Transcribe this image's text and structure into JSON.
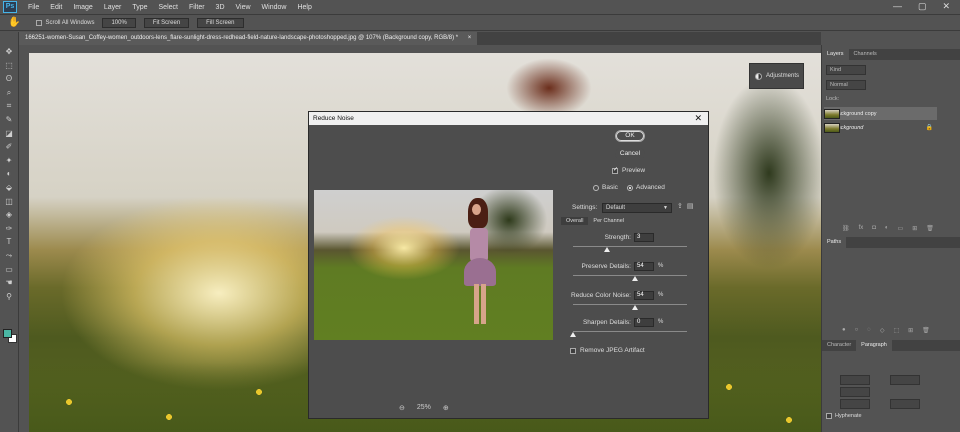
{
  "menubar": {
    "logo": "Ps",
    "items": [
      "File",
      "Edit",
      "Image",
      "Layer",
      "Type",
      "Select",
      "Filter",
      "3D",
      "View",
      "Window",
      "Help"
    ],
    "controls": [
      "—",
      "▢",
      "✕"
    ]
  },
  "options_bar": {
    "hand_icon": "hand-icon",
    "scroll_all_windows": "Scroll All Windows",
    "zoom_100": "100%",
    "fit_screen": "Fit Screen",
    "fill_screen": "Fill Screen"
  },
  "document": {
    "tab_title": "166251-women-Susan_Coffey-women_outdoors-lens_flare-sunlight-dress-redhead-field-nature-landscape-photoshopped.jpg @ 107% (Background copy, RGB/8) *",
    "close": "×"
  },
  "toolbar": {
    "tools": [
      "✥",
      "⬚",
      "ʘ",
      "⌕",
      "⌗",
      "✎",
      "◪",
      "✐",
      "✦",
      "◐",
      "⬙",
      "◫",
      "◈",
      "✑",
      "T",
      "⤳",
      "▭",
      "☚",
      "⚲"
    ],
    "foreground_color": "#4ab7a4",
    "background_color": "#ffffff"
  },
  "adjustments_panel": {
    "label": "Adjustments"
  },
  "layers_panel": {
    "tabs": [
      "Layers",
      "Channels"
    ],
    "search_placeholder": "Kind",
    "blend_mode": "Normal",
    "lock_row": "Lock:",
    "layers": [
      {
        "name": "Background copy",
        "selected": true
      },
      {
        "name": "Background",
        "selected": false
      }
    ],
    "footer_icons": [
      "⛓",
      "fx",
      "◘",
      "◐",
      "▭",
      "⊞",
      "🗑"
    ]
  },
  "paths_panel": {
    "tab": "Paths",
    "footer_icons": [
      "●",
      "○",
      "◌",
      "◇",
      "⬚",
      "⊞",
      "🗑"
    ]
  },
  "paragraph_panel": {
    "tabs": [
      "Character",
      "Paragraph"
    ],
    "hyphenate": "Hyphenate"
  },
  "dialog": {
    "title": "Reduce Noise",
    "close": "✕",
    "ok": "OK",
    "cancel": "Cancel",
    "preview_label": "Preview",
    "preview_checked": true,
    "mode_basic": "Basic",
    "mode_advanced": "Advanced",
    "mode_selected": "Advanced",
    "settings_label": "Settings:",
    "settings_value": "Default",
    "subtabs": [
      "Overall",
      "Per Channel"
    ],
    "sliders": [
      {
        "label": "Strength:",
        "value": "3",
        "unit": "",
        "level": 0.3
      },
      {
        "label": "Preserve Details:",
        "value": "54",
        "unit": "%",
        "level": 0.54
      },
      {
        "label": "Reduce Color Noise:",
        "value": "54",
        "unit": "%",
        "level": 0.54
      },
      {
        "label": "Sharpen Details:",
        "value": "0",
        "unit": "%",
        "level": 0.0
      }
    ],
    "remove_jpeg": "Remove JPEG Artifact",
    "remove_jpeg_checked": false,
    "zoom_out_icon": "zoom-out-icon",
    "zoom_level": "25%",
    "zoom_in_icon": "zoom-in-icon"
  }
}
